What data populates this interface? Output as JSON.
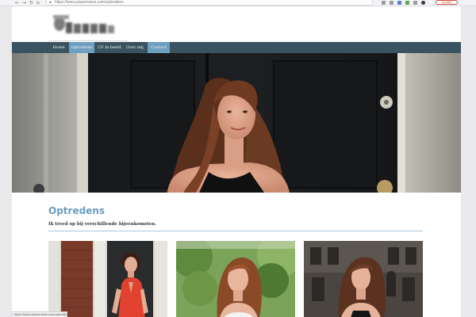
{
  "browser": {
    "url": "https://www.pianomeiss.com/optredens",
    "update_label": "Update",
    "status_text": "https://www.pianomeiss.com/optredens"
  },
  "site": {
    "logo_text": "",
    "nav": {
      "home": "Home",
      "optredens": "Optredens",
      "cv": "CV in beeld",
      "over": "Over mij",
      "contact": "Contact"
    },
    "active_nav": "optredens",
    "accent_color": "#6e9fc0",
    "navbar_color": "#3b5360"
  },
  "content": {
    "title": "Optredens",
    "subtitle": "Ik treed op bij verschillende bijeenkomsten."
  },
  "gallery": {
    "items": [
      {
        "alt": "Zangeres in rode jurk"
      },
      {
        "alt": "Zangeres buiten bij groen"
      },
      {
        "alt": "Zangeres voor stadsgevel"
      }
    ]
  }
}
